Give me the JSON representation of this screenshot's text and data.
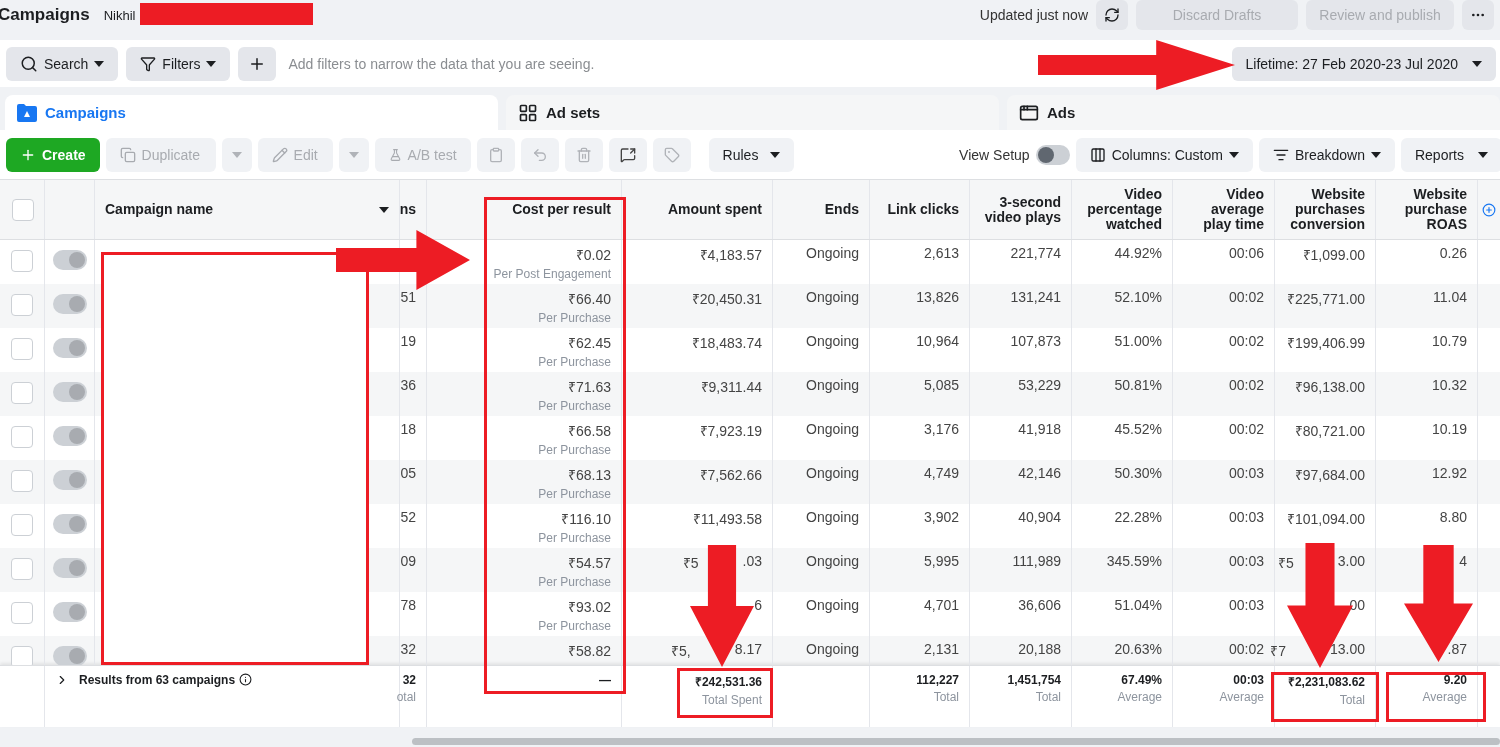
{
  "header": {
    "title": "Campaigns",
    "account_name": "Nikhil",
    "updated": "Updated just now",
    "discard": "Discard Drafts",
    "review": "Review and publish"
  },
  "filter_bar": {
    "search": "Search",
    "filters": "Filters",
    "placeholder": "Add filters to narrow the data that you are seeing.",
    "date_range": "Lifetime: 27 Feb 2020-23 Jul 2020"
  },
  "tabs": [
    {
      "label": "Campaigns",
      "kind": "campaigns",
      "selected": true
    },
    {
      "label": "Ad sets",
      "kind": "adsets",
      "selected": false
    },
    {
      "label": "Ads",
      "kind": "ads",
      "selected": false
    }
  ],
  "toolbar": {
    "create": "Create",
    "duplicate": {
      "label": "Duplicate",
      "disabled": true
    },
    "edit": {
      "label": "Edit",
      "disabled": true
    },
    "ab_test": {
      "label": "A/B test",
      "disabled": true
    },
    "rules": "Rules",
    "view_setup": {
      "label": "View Setup",
      "on": false
    },
    "columns": "Columns: Custom",
    "breakdown": "Breakdown",
    "reports": "Reports"
  },
  "table": {
    "name_column": "Campaign name",
    "select_all": {
      "checked": false
    },
    "columns": [
      "ns",
      "Cost per result",
      "Amount spent",
      "Ends",
      "Link clicks",
      "3-second video plays",
      "Video percentage watched",
      "Video average play time",
      "Website purchases conversion",
      "Website purchase ROAS"
    ],
    "rows": [
      {
        "checked": false,
        "on": true,
        "cost": "₹0.02",
        "cost_label": "Per Post Engagement",
        "amount": "₹4,183.57",
        "ends": "Ongoing",
        "link_clicks": "2,613",
        "video_plays": "221,774",
        "pct_watched": "44.92%",
        "avg_play": "00:06",
        "conversion": "₹1,099.00",
        "roas": "0.26"
      },
      {
        "checked": false,
        "on": true,
        "results": "51",
        "cost": "₹66.40",
        "cost_label": "Per Purchase",
        "amount": "₹20,450.31",
        "ends": "Ongoing",
        "link_clicks": "13,826",
        "video_plays": "131,241",
        "pct_watched": "52.10%",
        "avg_play": "00:02",
        "conversion": "₹225,771.00",
        "roas": "11.04"
      },
      {
        "checked": false,
        "on": true,
        "results": "19",
        "cost": "₹62.45",
        "cost_label": "Per Purchase",
        "amount": "₹18,483.74",
        "ends": "Ongoing",
        "link_clicks": "10,964",
        "video_plays": "107,873",
        "pct_watched": "51.00%",
        "avg_play": "00:02",
        "conversion": "₹199,406.99",
        "roas": "10.79"
      },
      {
        "checked": false,
        "on": true,
        "results": "36",
        "cost": "₹71.63",
        "cost_label": "Per Purchase",
        "amount": "₹9,311.44",
        "ends": "Ongoing",
        "link_clicks": "5,085",
        "video_plays": "53,229",
        "pct_watched": "50.81%",
        "avg_play": "00:02",
        "conversion": "₹96,138.00",
        "roas": "10.32"
      },
      {
        "checked": false,
        "on": true,
        "results": "18",
        "cost": "₹66.58",
        "cost_label": "Per Purchase",
        "amount": "₹7,923.19",
        "ends": "Ongoing",
        "link_clicks": "3,176",
        "video_plays": "41,918",
        "pct_watched": "45.52%",
        "avg_play": "00:02",
        "conversion": "₹80,721.00",
        "roas": "10.19"
      },
      {
        "checked": false,
        "on": true,
        "results": "05",
        "cost": "₹68.13",
        "cost_label": "Per Purchase",
        "amount": "₹7,562.66",
        "ends": "Ongoing",
        "link_clicks": "4,749",
        "video_plays": "42,146",
        "pct_watched": "50.30%",
        "avg_play": "00:03",
        "conversion": "₹97,684.00",
        "roas": "12.92"
      },
      {
        "checked": false,
        "on": true,
        "results": "52",
        "cost": "₹116.10",
        "cost_label": "Per Purchase",
        "amount": "₹11,493.58",
        "ends": "Ongoing",
        "link_clicks": "3,902",
        "video_plays": "40,904",
        "pct_watched": "22.28%",
        "avg_play": "00:03",
        "conversion": "₹101,094.00",
        "roas": "8.80"
      },
      {
        "checked": false,
        "on": true,
        "results": "09",
        "cost": "₹54.57",
        "cost_label": "Per Purchase",
        "amount": [
          "₹5",
          ".03"
        ],
        "ends": "Ongoing",
        "link_clicks": "5,995",
        "video_plays": "111,989",
        "pct_watched": "345.59%",
        "avg_play": "00:03",
        "conversion": [
          "₹5",
          "3.00"
        ],
        "roas": [
          "4"
        ]
      },
      {
        "checked": false,
        "on": true,
        "results": "78",
        "cost": "₹93.02",
        "cost_label": "Per Purchase",
        "amount": [
          "6"
        ],
        "ends": "Ongoing",
        "link_clicks": "4,701",
        "video_plays": "36,606",
        "pct_watched": "51.04%",
        "avg_play": "00:03",
        "conversion": [
          "00"
        ]
      },
      {
        "checked": false,
        "on": true,
        "results": "32",
        "cost": "₹58.82",
        "amount": [
          "₹5,",
          "8.17"
        ],
        "ends": "Ongoing",
        "link_clicks": "2,131",
        "video_plays": "20,188",
        "pct_watched": "20.63%",
        "avg_play": "00:02",
        "conversion": [
          "₹7",
          "13.00"
        ],
        "roas": [
          ".87"
        ]
      }
    ],
    "footer": {
      "label": "Results from 63 campaigns",
      "results": {
        "value": "32",
        "note": "otal"
      },
      "cost": {
        "value": "—"
      },
      "amount": {
        "value": "₹242,531.36",
        "note": "Total Spent"
      },
      "link_clicks": {
        "value": "112,227",
        "note": "Total"
      },
      "video_plays": {
        "value": "1,451,754",
        "note": "Total"
      },
      "pct_watched": {
        "value": "67.49%",
        "note": "Average"
      },
      "avg_play": {
        "value": "00:03",
        "note": "Average"
      },
      "conversion": {
        "value": "₹2,231,083.62",
        "note": "Total"
      },
      "roas": {
        "value": "9.20",
        "note": "Average"
      }
    }
  }
}
